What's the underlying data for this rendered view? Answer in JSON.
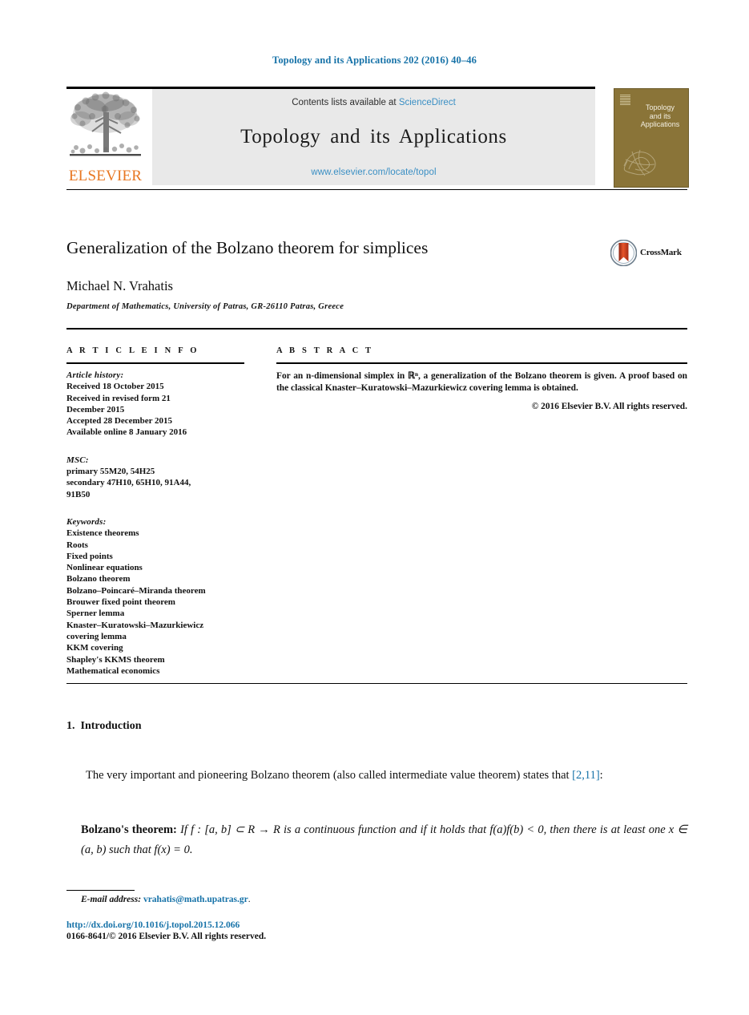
{
  "running_head": "Topology and its Applications 202 (2016) 40–46",
  "masthead": {
    "contents_text": "Contents lists available at ",
    "sciencedirect": "ScienceDirect",
    "journal_name": "Topology and its Applications",
    "journal_url": "www.elsevier.com/locate/topol",
    "publisher_wordmark": "ELSEVIER",
    "publisher_logo_icon": "elsevier-tree-icon",
    "cover": {
      "line1": "Topology",
      "line2": "and its",
      "line3": "Applications",
      "bg_color": "#8a7438"
    }
  },
  "article": {
    "title": "Generalization of the Bolzano theorem for simplices",
    "author": "Michael N. Vrahatis",
    "affiliation": "Department of Mathematics, University of Patras, GR-26110 Patras, Greece",
    "crossmark_label": "CrossMark"
  },
  "info": {
    "heading": "A R T I C L E   I N F O",
    "history_label": "Article history:",
    "history": [
      "Received 18 October 2015",
      "Received in revised form 21",
      "December 2015",
      "Accepted 28 December 2015",
      "Available online 8 January 2016"
    ],
    "msc_label": "MSC:",
    "msc": [
      "primary 55M20, 54H25",
      "secondary 47H10, 65H10, 91A44,",
      "91B50"
    ],
    "keywords_label": "Keywords:",
    "keywords": [
      "Existence theorems",
      "Roots",
      "Fixed points",
      "Nonlinear equations",
      "Bolzano theorem",
      "Bolzano–Poincaré–Miranda theorem",
      "Brouwer fixed point theorem",
      "Sperner lemma",
      "Knaster–Kuratowski–Mazurkiewicz",
      "covering lemma",
      "KKM covering",
      "Shapley's KKMS theorem",
      "Mathematical economics"
    ]
  },
  "abstract": {
    "heading": "A B S T R A C T",
    "text": "For an n-dimensional simplex in ℝⁿ, a generalization of the Bolzano theorem is given. A proof based on the classical Knaster–Kuratowski–Mazurkiewicz covering lemma is obtained.",
    "copyright": "© 2016 Elsevier B.V. All rights reserved."
  },
  "body": {
    "section_number": "1.",
    "section_title": "Introduction",
    "paragraph_before_cite": "The very important and pioneering Bolzano theorem (also called intermediate value theorem) states that ",
    "citation": "[2,11]",
    "paragraph_after_cite": ":",
    "theorem_name": "Bolzano's theorem:",
    "theorem_text": "If f : [a, b] ⊂ R → R is a continuous function and if it holds that f(a)f(b) < 0, then there is at least one x ∈ (a, b) such that f(x) = 0."
  },
  "footer": {
    "email_label": "E-mail address:",
    "email": "vrahatis@math.upatras.gr",
    "email_suffix": ".",
    "doi": "http://dx.doi.org/10.1016/j.topol.2015.12.066",
    "issn": "0166-8641/© 2016 Elsevier B.V. All rights reserved."
  },
  "colors": {
    "link_blue": "#1672a8",
    "sd_blue": "#3a8fc4",
    "elsevier_orange": "#E87722",
    "cover_brown": "#8a7438"
  }
}
